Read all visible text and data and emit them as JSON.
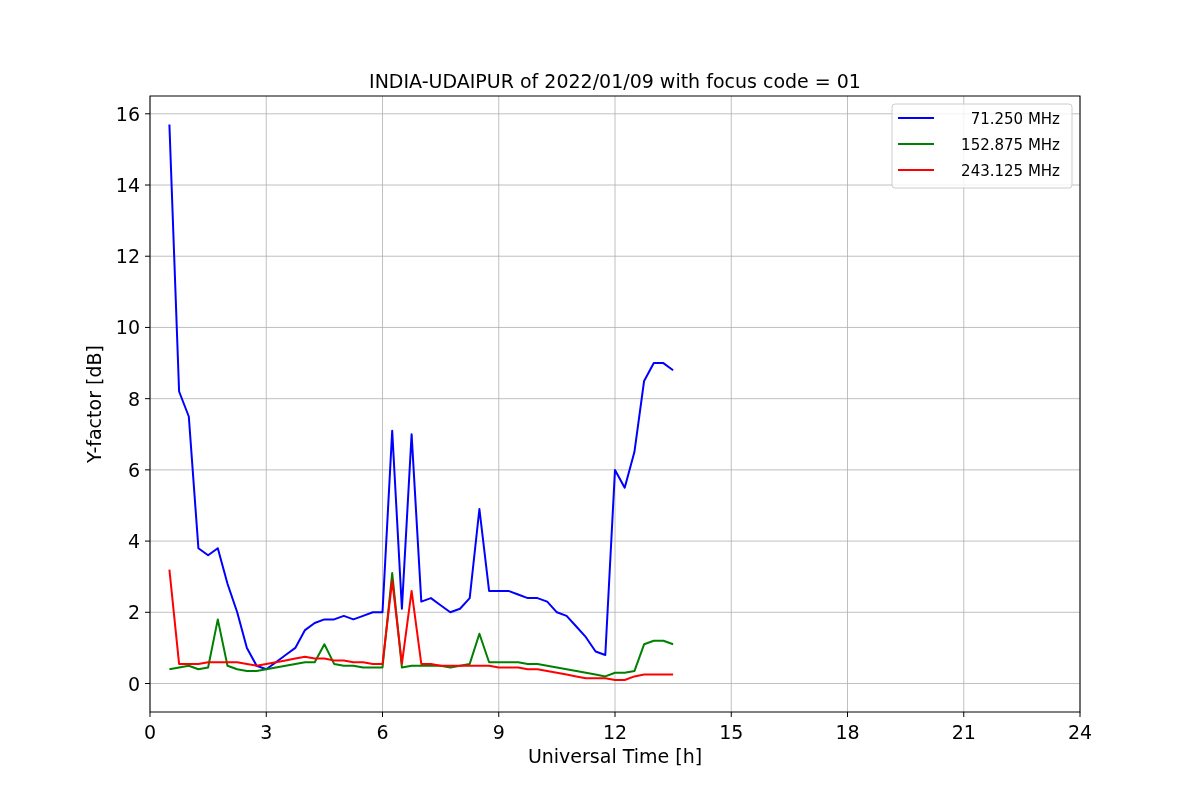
{
  "chart_data": {
    "type": "line",
    "title": "INDIA-UDAIPUR of 2022/01/09 with focus code = 01",
    "xlabel": "Universal Time [h]",
    "ylabel": "Y-factor [dB]",
    "x": [
      0.5,
      0.75,
      1.0,
      1.25,
      1.5,
      1.75,
      2.0,
      2.25,
      2.5,
      2.75,
      3.0,
      3.25,
      3.5,
      3.75,
      4.0,
      4.25,
      4.5,
      4.75,
      5.0,
      5.25,
      5.5,
      5.75,
      6.0,
      6.25,
      6.5,
      6.75,
      7.0,
      7.25,
      7.5,
      7.75,
      8.0,
      8.25,
      8.5,
      8.75,
      9.0,
      9.25,
      9.5,
      9.75,
      10.0,
      10.25,
      10.5,
      10.75,
      11.0,
      11.25,
      11.5,
      11.75,
      12.0,
      12.25,
      12.5,
      12.75,
      13.0,
      13.25,
      13.5
    ],
    "series": [
      {
        "name": "71.250 MHz",
        "color": "#0000ff",
        "values": [
          15.7,
          8.2,
          7.5,
          3.8,
          3.6,
          3.8,
          2.8,
          2.0,
          1.0,
          0.5,
          0.4,
          0.6,
          0.8,
          1.0,
          1.5,
          1.7,
          1.8,
          1.8,
          1.9,
          1.8,
          1.9,
          2.0,
          2.0,
          7.1,
          2.1,
          7.0,
          2.3,
          2.4,
          2.2,
          2.0,
          2.1,
          2.4,
          4.9,
          2.6,
          2.6,
          2.6,
          2.5,
          2.4,
          2.4,
          2.3,
          2.0,
          1.9,
          1.6,
          1.3,
          0.9,
          0.8,
          6.0,
          5.5,
          6.5,
          8.5,
          9.0,
          9.0,
          8.8
        ]
      },
      {
        "name": "152.875 MHz",
        "color": "#008000",
        "values": [
          0.4,
          0.45,
          0.5,
          0.4,
          0.45,
          1.8,
          0.5,
          0.4,
          0.35,
          0.35,
          0.4,
          0.45,
          0.5,
          0.55,
          0.6,
          0.6,
          1.1,
          0.55,
          0.5,
          0.5,
          0.45,
          0.45,
          0.45,
          3.1,
          0.45,
          0.5,
          0.5,
          0.5,
          0.5,
          0.45,
          0.5,
          0.55,
          1.4,
          0.6,
          0.6,
          0.6,
          0.6,
          0.55,
          0.55,
          0.5,
          0.45,
          0.4,
          0.35,
          0.3,
          0.25,
          0.2,
          0.3,
          0.3,
          0.35,
          1.1,
          1.2,
          1.2,
          1.1
        ]
      },
      {
        "name": "243.125 MHz",
        "color": "#ff0000",
        "values": [
          3.2,
          0.55,
          0.55,
          0.55,
          0.6,
          0.6,
          0.6,
          0.6,
          0.55,
          0.5,
          0.55,
          0.6,
          0.65,
          0.7,
          0.75,
          0.7,
          0.7,
          0.65,
          0.65,
          0.6,
          0.6,
          0.55,
          0.55,
          2.9,
          0.55,
          2.6,
          0.55,
          0.55,
          0.5,
          0.5,
          0.5,
          0.5,
          0.5,
          0.5,
          0.45,
          0.45,
          0.45,
          0.4,
          0.4,
          0.35,
          0.3,
          0.25,
          0.2,
          0.15,
          0.15,
          0.15,
          0.1,
          0.1,
          0.2,
          0.25,
          0.25,
          0.25,
          0.25
        ]
      }
    ],
    "xlim": [
      0,
      24
    ],
    "ylim": [
      -0.8,
      16.5
    ],
    "xticks": [
      0,
      3,
      6,
      9,
      12,
      15,
      18,
      21,
      24
    ],
    "yticks": [
      0,
      2,
      4,
      6,
      8,
      10,
      12,
      14,
      16
    ],
    "grid": true,
    "legend": true
  }
}
